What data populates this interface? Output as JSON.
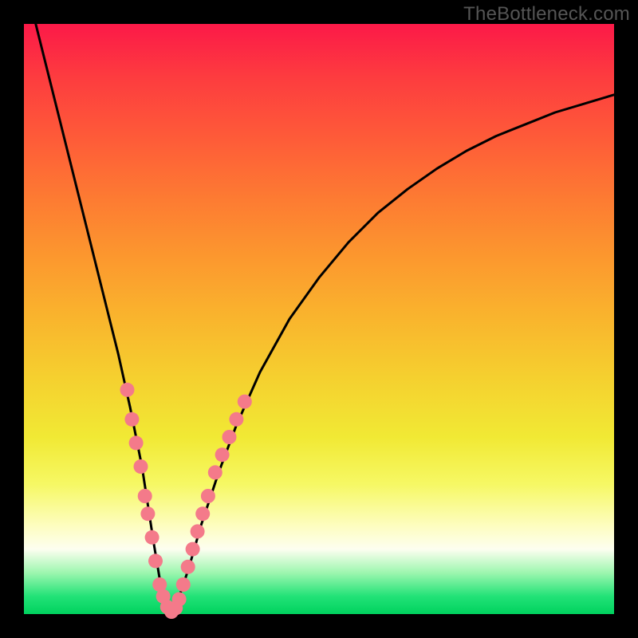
{
  "watermark": "TheBottleneck.com",
  "chart_data": {
    "type": "line",
    "title": "",
    "xlabel": "",
    "ylabel": "",
    "xlim": [
      0,
      100
    ],
    "ylim": [
      0,
      100
    ],
    "grid": false,
    "legend": false,
    "series": [
      {
        "name": "bottleneck-curve",
        "x": [
          0,
          2,
          4,
          6,
          8,
          10,
          12,
          14,
          16,
          18,
          20,
          22,
          23,
          24,
          25,
          26,
          28,
          30,
          33,
          36,
          40,
          45,
          50,
          55,
          60,
          65,
          70,
          75,
          80,
          85,
          90,
          95,
          100
        ],
        "values": [
          108,
          100,
          92,
          84,
          76,
          68,
          60,
          52,
          44,
          35,
          25,
          12,
          6,
          2,
          0,
          2,
          8,
          15,
          24,
          32,
          41,
          50,
          57,
          63,
          68,
          72,
          75.5,
          78.5,
          81,
          83,
          85,
          86.5,
          88
        ]
      }
    ],
    "markers": {
      "name": "highlight-points",
      "color": "#f47a8a",
      "points": [
        {
          "x": 17.5,
          "y": 38
        },
        {
          "x": 18.3,
          "y": 33
        },
        {
          "x": 19.0,
          "y": 29
        },
        {
          "x": 19.8,
          "y": 25
        },
        {
          "x": 20.5,
          "y": 20
        },
        {
          "x": 21.0,
          "y": 17
        },
        {
          "x": 21.7,
          "y": 13
        },
        {
          "x": 22.3,
          "y": 9
        },
        {
          "x": 23.0,
          "y": 5
        },
        {
          "x": 23.6,
          "y": 3
        },
        {
          "x": 24.3,
          "y": 1.2
        },
        {
          "x": 25.0,
          "y": 0.4
        },
        {
          "x": 25.7,
          "y": 1.0
        },
        {
          "x": 26.3,
          "y": 2.5
        },
        {
          "x": 27.0,
          "y": 5
        },
        {
          "x": 27.8,
          "y": 8
        },
        {
          "x": 28.6,
          "y": 11
        },
        {
          "x": 29.4,
          "y": 14
        },
        {
          "x": 30.3,
          "y": 17
        },
        {
          "x": 31.2,
          "y": 20
        },
        {
          "x": 32.4,
          "y": 24
        },
        {
          "x": 33.6,
          "y": 27
        },
        {
          "x": 34.8,
          "y": 30
        },
        {
          "x": 36.0,
          "y": 33
        },
        {
          "x": 37.4,
          "y": 36
        }
      ]
    }
  }
}
